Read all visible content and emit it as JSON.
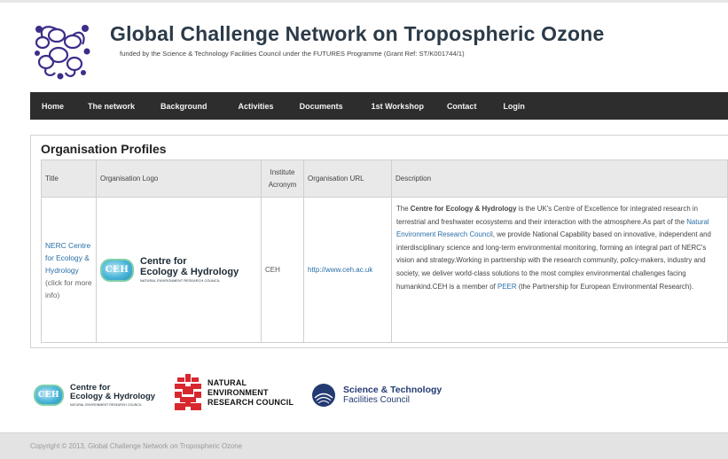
{
  "header": {
    "title": "Global Challenge Network on Tropospheric Ozone",
    "subtitle": "funded by the Science & Technology Facilities Council under the FUTURES Programme (Grant Ref: ST/K001744/1)"
  },
  "nav": {
    "items": [
      "Home",
      "The network",
      "Background",
      "Activities",
      "Documents",
      "1st Workshop",
      "Contact",
      "Login"
    ]
  },
  "main": {
    "section_title": "Organisation Profiles",
    "table": {
      "headers": [
        "Title",
        "Organisation Logo",
        "Institute Acronym",
        "Organisation URL",
        "Description"
      ],
      "rows": [
        {
          "title_link": "NERC Centre for Ecology & Hydrology",
          "title_note": "(click for more info)",
          "logo": {
            "badge": "CEH",
            "line1": "Centre for",
            "line2": "Ecology & Hydrology",
            "line3": "NATURAL ENVIRONMENT RESEARCH COUNCIL"
          },
          "acronym": "CEH",
          "url": "http://www.ceh.ac.uk",
          "description": {
            "p1_pre": "The ",
            "p1_bold": "Centre for Ecology & Hydrology",
            "p1_post": " is the UK's Centre of Excellence for integrated research in terrestrial and freshwater ecosystems and their interaction with the atmosphere.As part of the ",
            "p1_link": "Natural Environment Research Council",
            "p2": ", we provide National Capability based on innovative, independent and interdisciplinary science and long-term environmental monitoring, forming an integral part of NERC's vision and strategy.Working in partnership with the research community, policy-makers, industry and society, we deliver world-class solutions to the most complex environmental challenges facing humankind.CEH is a member of ",
            "p2_link": "PEER",
            "p3": " (the Partnership for European Environmental Research)."
          }
        }
      ]
    }
  },
  "footer": {
    "ceh": {
      "badge": "CEH",
      "line1": "Centre for",
      "line2": "Ecology & Hydrology",
      "line3": "NATURAL ENVIRONMENT RESEARCH COUNCIL"
    },
    "nerc": {
      "line1": "NATURAL",
      "line2": "ENVIRONMENT",
      "line3": "RESEARCH COUNCIL"
    },
    "stfc": {
      "line1": "Science & Technology",
      "line2": "Facilities Council"
    },
    "copyright": "Copyright © 2013, Global Challenge Network on Tropospheric Ozone"
  },
  "colors": {
    "nav_bg": "#2d2d2d",
    "link": "#2a6fa8",
    "title": "#2b3a48",
    "nerc_red": "#d7282f",
    "stfc_blue": "#233a73"
  },
  "icons": {
    "site_logo": "molecule-logo-icon",
    "nerc": "nerc-logo-icon",
    "stfc": "stfc-logo-icon"
  }
}
